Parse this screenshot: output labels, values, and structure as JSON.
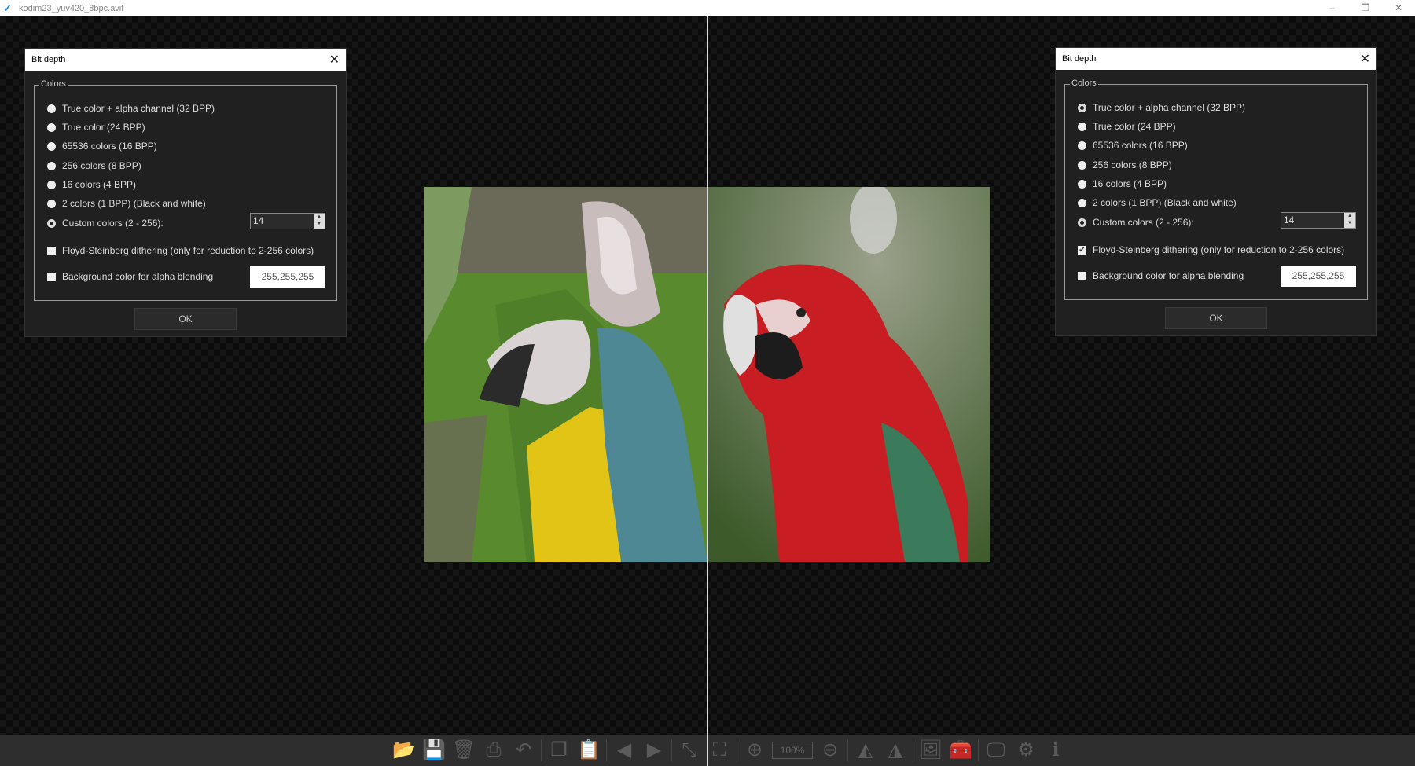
{
  "window": {
    "title": "kodim23_yuv420_8bpc.avif",
    "minimize": "–",
    "restore": "❐",
    "close": "✕"
  },
  "dialogs": [
    {
      "title": "Bit depth",
      "group": "Colors",
      "options": [
        "True color + alpha channel (32 BPP)",
        "True color (24 BPP)",
        "65536 colors (16 BPP)",
        "256 colors (8 BPP)",
        "16 colors (4 BPP)",
        "2 colors (1 BPP) (Black and white)",
        "Custom colors (2 - 256):"
      ],
      "selected": 6,
      "custom_value": "14",
      "dither_label": "Floyd-Steinberg dithering (only for reduction to 2-256 colors)",
      "dither_checked": false,
      "bg_label": "Background color for alpha blending",
      "bg_checked": false,
      "bg_value": "255,255,255",
      "ok": "OK"
    },
    {
      "title": "Bit depth",
      "group": "Colors",
      "options": [
        "True color + alpha channel (32 BPP)",
        "True color (24 BPP)",
        "65536 colors (16 BPP)",
        "256 colors (8 BPP)",
        "16 colors (4 BPP)",
        "2 colors (1 BPP) (Black and white)",
        "Custom colors (2 - 256):"
      ],
      "selected": 6,
      "custom_value": "14",
      "dither_label": "Floyd-Steinberg dithering (only for reduction to 2-256 colors)",
      "dither_checked": true,
      "bg_label": "Background color for alpha blending",
      "bg_checked": false,
      "bg_value": "255,255,255",
      "ok": "OK"
    }
  ],
  "toolbar": {
    "zoom": "100%"
  }
}
